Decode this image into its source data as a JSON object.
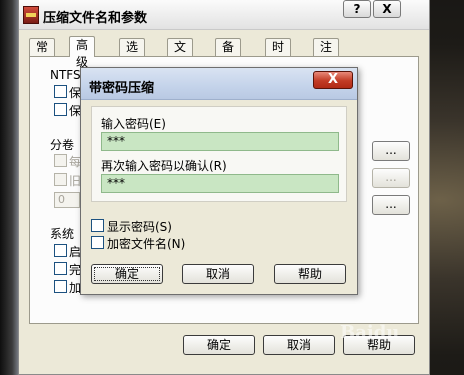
{
  "outer_window": {
    "title": "压缩文件名和参数",
    "title_buttons": {
      "help": "?",
      "close": "X"
    },
    "tabs": [
      "常规",
      "高级",
      "选项",
      "文件",
      "备份",
      "时间",
      "注释"
    ],
    "active_tab": "高级",
    "panel": {
      "ntfs_label": "NTFS",
      "ntfs_item_1": "保",
      "ntfs_item_2": "保",
      "split_label": "分卷",
      "split_item_1": "每",
      "split_item_2": "旧",
      "split_value": "0",
      "system_label": "系统",
      "system_item_1": "启",
      "system_item_2": "完",
      "system_item_3": "加",
      "side_button_1": "...",
      "side_button_2": "...",
      "side_button_3": "..."
    },
    "bottom_buttons": {
      "ok": "确定",
      "cancel": "取消",
      "help": "帮助"
    }
  },
  "password_dialog": {
    "title": "带密码压缩",
    "close_glyph": "X",
    "enter_password_label": "输入密码(E)",
    "enter_password_value": "***",
    "reenter_password_label": "再次输入密码以确认(R)",
    "reenter_password_value": "***",
    "show_password_label": "显示密码(S)",
    "encrypt_names_label": "加密文件名(N)",
    "buttons": {
      "ok": "确定",
      "cancel": "取消",
      "help": "帮助"
    }
  },
  "watermark": "Baidu"
}
